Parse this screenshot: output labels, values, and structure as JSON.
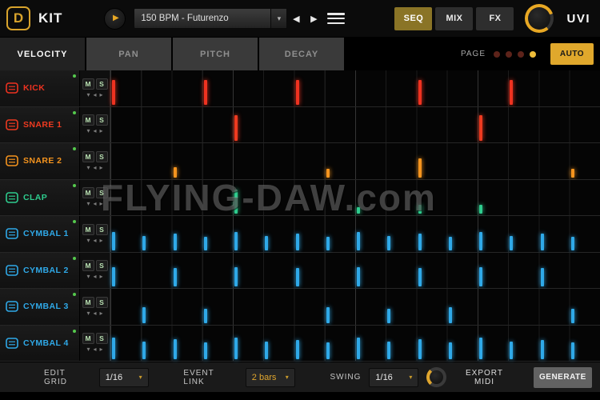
{
  "header": {
    "logo_glyph": "D",
    "title": "KIT",
    "preset": "150 BPM - Futurenzo",
    "tabs": [
      {
        "label": "SEQ",
        "active": true
      },
      {
        "label": "MIX",
        "active": false
      },
      {
        "label": "FX",
        "active": false
      }
    ],
    "brand": "UVI"
  },
  "icons": {
    "play": "▶",
    "prev": "◀",
    "next": "▶",
    "chevron": "▾",
    "tri_down": "▾",
    "tri_left": "◂",
    "tri_right": "▸"
  },
  "param_tabs": {
    "items": [
      {
        "label": "VELOCITY",
        "active": true
      },
      {
        "label": "PAN",
        "active": false
      },
      {
        "label": "PITCH",
        "active": false
      },
      {
        "label": "DECAY",
        "active": false
      }
    ],
    "page_label": "PAGE",
    "page_dots": [
      false,
      false,
      false,
      true
    ],
    "auto_label": "AUTO"
  },
  "sequencer": {
    "steps_per_page": 16,
    "mute_label": "M",
    "solo_label": "S",
    "tracks": [
      {
        "name": "KICK",
        "color": "#ee3220",
        "steps": [
          {
            "step": 1,
            "vel": 0.82
          },
          {
            "step": 4,
            "vel": 0.82
          },
          {
            "step": 7,
            "vel": 0.82
          },
          {
            "step": 11,
            "vel": 0.82
          },
          {
            "step": 14,
            "vel": 0.82
          }
        ]
      },
      {
        "name": "SNARE 1",
        "color": "#ee3a20",
        "steps": [
          {
            "step": 5,
            "vel": 0.85
          },
          {
            "step": 13,
            "vel": 0.85
          }
        ]
      },
      {
        "name": "SNARE 2",
        "color": "#f5941e",
        "steps": [
          {
            "step": 3,
            "vel": 0.35
          },
          {
            "step": 8,
            "vel": 0.3
          },
          {
            "step": 11,
            "vel": 0.62
          },
          {
            "step": 16,
            "vel": 0.3
          }
        ]
      },
      {
        "name": "CLAP",
        "color": "#2ecc8e",
        "steps": [
          {
            "step": 5,
            "vel": 0.78
          },
          {
            "step": 9,
            "vel": 0.22
          },
          {
            "step": 11,
            "vel": 0.28
          },
          {
            "step": 13,
            "vel": 0.28
          }
        ]
      },
      {
        "name": "CYMBAL 1",
        "color": "#2fa9e8",
        "steps": [
          {
            "step": 1,
            "vel": 0.6
          },
          {
            "step": 2,
            "vel": 0.48
          },
          {
            "step": 3,
            "vel": 0.56
          },
          {
            "step": 4,
            "vel": 0.46
          },
          {
            "step": 5,
            "vel": 0.6
          },
          {
            "step": 6,
            "vel": 0.48
          },
          {
            "step": 7,
            "vel": 0.54
          },
          {
            "step": 8,
            "vel": 0.46
          },
          {
            "step": 9,
            "vel": 0.6
          },
          {
            "step": 10,
            "vel": 0.48
          },
          {
            "step": 11,
            "vel": 0.56
          },
          {
            "step": 12,
            "vel": 0.46
          },
          {
            "step": 13,
            "vel": 0.6
          },
          {
            "step": 14,
            "vel": 0.48
          },
          {
            "step": 15,
            "vel": 0.54
          },
          {
            "step": 16,
            "vel": 0.46
          }
        ]
      },
      {
        "name": "CYMBAL 2",
        "color": "#2fa9e8",
        "steps": [
          {
            "step": 1,
            "vel": 0.62
          },
          {
            "step": 3,
            "vel": 0.6
          },
          {
            "step": 5,
            "vel": 0.62
          },
          {
            "step": 7,
            "vel": 0.6
          },
          {
            "step": 9,
            "vel": 0.62
          },
          {
            "step": 11,
            "vel": 0.6
          },
          {
            "step": 13,
            "vel": 0.62
          },
          {
            "step": 15,
            "vel": 0.6
          }
        ]
      },
      {
        "name": "CYMBAL 3",
        "color": "#2fa9e8",
        "steps": [
          {
            "step": 2,
            "vel": 0.52
          },
          {
            "step": 4,
            "vel": 0.48
          },
          {
            "step": 8,
            "vel": 0.52
          },
          {
            "step": 10,
            "vel": 0.48
          },
          {
            "step": 12,
            "vel": 0.52
          },
          {
            "step": 16,
            "vel": 0.48
          }
        ]
      },
      {
        "name": "CYMBAL 4",
        "color": "#2fa9e8",
        "steps": [
          {
            "step": 1,
            "vel": 0.7
          },
          {
            "step": 2,
            "vel": 0.58
          },
          {
            "step": 3,
            "vel": 0.66
          },
          {
            "step": 4,
            "vel": 0.56
          },
          {
            "step": 5,
            "vel": 0.7
          },
          {
            "step": 6,
            "vel": 0.58
          },
          {
            "step": 7,
            "vel": 0.64
          },
          {
            "step": 8,
            "vel": 0.56
          },
          {
            "step": 9,
            "vel": 0.7
          },
          {
            "step": 10,
            "vel": 0.58
          },
          {
            "step": 11,
            "vel": 0.66
          },
          {
            "step": 12,
            "vel": 0.56
          },
          {
            "step": 13,
            "vel": 0.7
          },
          {
            "step": 14,
            "vel": 0.58
          },
          {
            "step": 15,
            "vel": 0.64
          },
          {
            "step": 16,
            "vel": 0.56
          }
        ]
      }
    ]
  },
  "watermark": "FLYING-DAW.com",
  "footer": {
    "edit_grid_label": "EDIT GRID",
    "edit_grid_value": "1/16",
    "event_link_label": "EVENT LINK",
    "event_link_value": "2 bars",
    "swing_label": "SWING",
    "swing_value": "1/16",
    "export_label": "EXPORT MIDI",
    "generate_label": "GENERATE"
  }
}
